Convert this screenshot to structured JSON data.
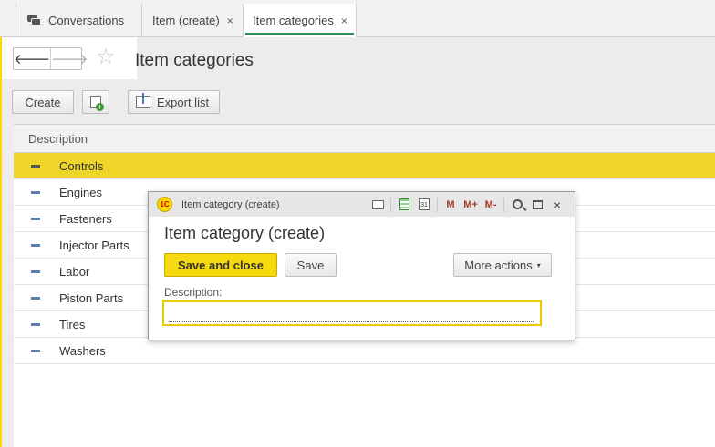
{
  "tabs": [
    {
      "label": "Conversations",
      "icon": "chat-icon"
    },
    {
      "label": "Item (create)",
      "close": "×"
    },
    {
      "label": "Item categories",
      "close": "×",
      "active": true
    }
  ],
  "page": {
    "back": "🡐",
    "forward": "🡒",
    "star": "☆",
    "title": "Item categories"
  },
  "toolbar": {
    "create_label": "Create",
    "export_label": "Export list"
  },
  "list": {
    "column_header": "Description",
    "rows": [
      "Controls",
      "Engines",
      "Fasteners",
      "Injector Parts",
      "Labor",
      "Piston Parts",
      "Tires",
      "Washers"
    ],
    "selected_index": 0
  },
  "dialog": {
    "logo": "1С",
    "window_title": "Item category (create)",
    "tools": {
      "calendar_day": "31",
      "m": "M",
      "m_plus": "M+",
      "m_minus": "M-",
      "close": "×"
    },
    "heading": "Item category (create)",
    "save_close_label": "Save and close",
    "save_label": "Save",
    "more_actions_label": "More actions",
    "more_caret": "▾",
    "description_label": "Description:",
    "description_value": ""
  },
  "colors": {
    "accent_yellow": "#f6d90e",
    "selected_row": "#efd52a",
    "active_tab_underline": "#2e8b57"
  }
}
